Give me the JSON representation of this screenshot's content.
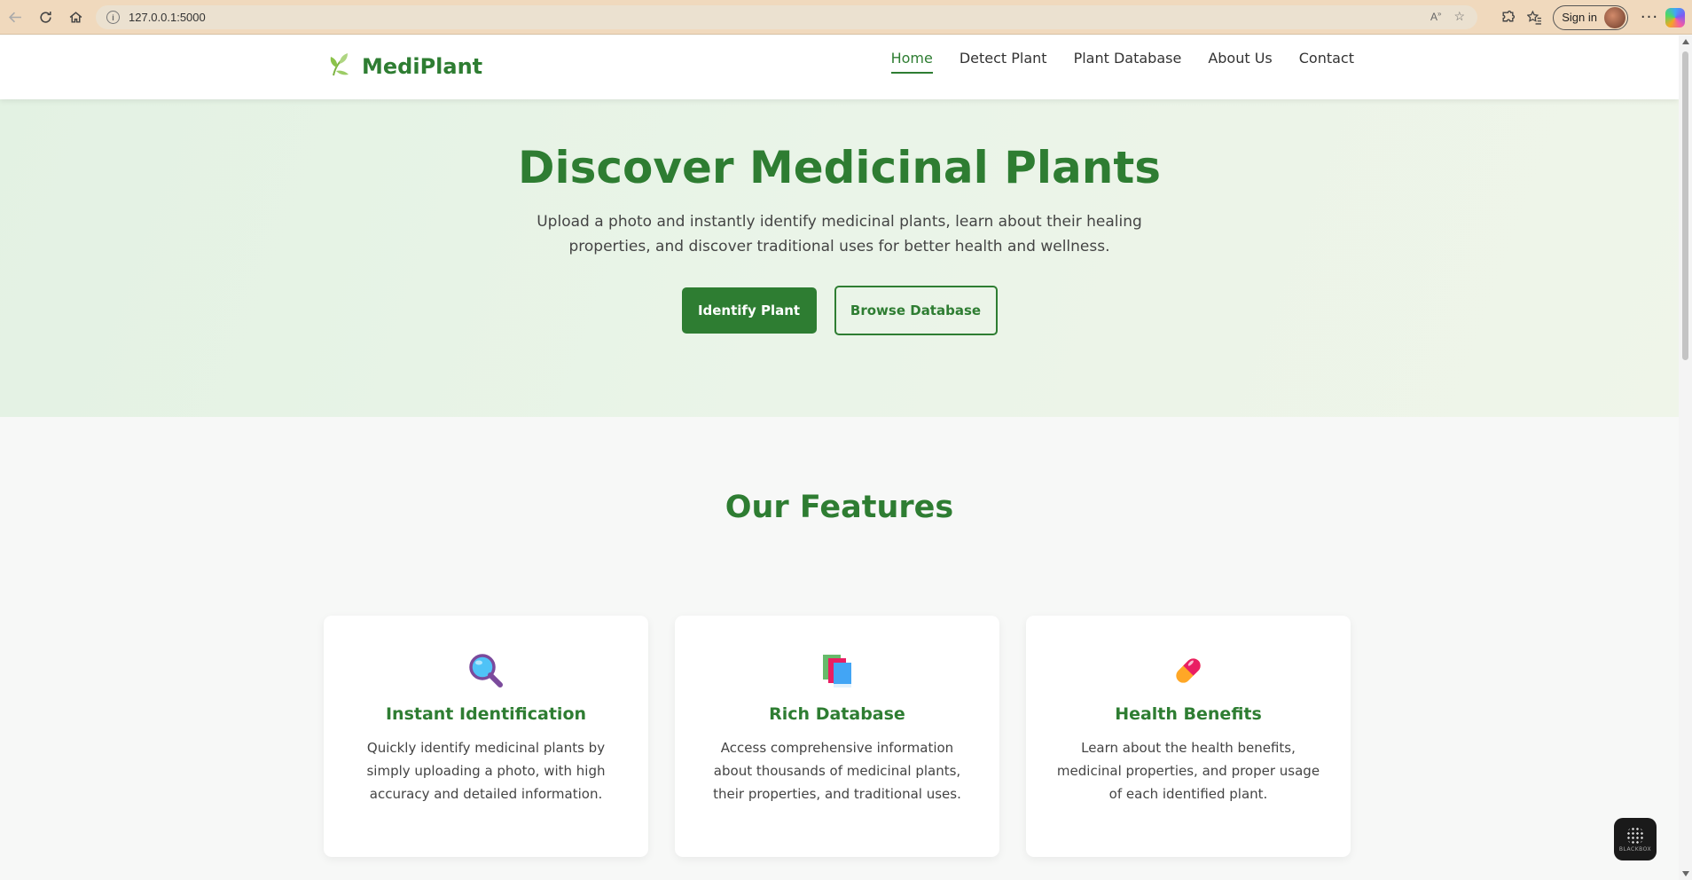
{
  "browser": {
    "url": "127.0.0.1:5000",
    "sign_in_label": "Sign in"
  },
  "site": {
    "brand": "MediPlant",
    "nav": [
      {
        "label": "Home",
        "active": true
      },
      {
        "label": "Detect Plant",
        "active": false
      },
      {
        "label": "Plant Database",
        "active": false
      },
      {
        "label": "About Us",
        "active": false
      },
      {
        "label": "Contact",
        "active": false
      }
    ]
  },
  "hero": {
    "title": "Discover Medicinal Plants",
    "subtitle": "Upload a photo and instantly identify medicinal plants, learn about their healing properties, and discover traditional uses for better health and wellness.",
    "primary_button": "Identify Plant",
    "secondary_button": "Browse Database"
  },
  "features": {
    "heading": "Our Features",
    "cards": [
      {
        "icon": "magnifier-icon",
        "title": "Instant Identification",
        "text": "Quickly identify medicinal plants by simply uploading a photo, with high accuracy and detailed information."
      },
      {
        "icon": "books-icon",
        "title": "Rich Database",
        "text": "Access comprehensive information about thousands of medicinal plants, their properties, and traditional uses."
      },
      {
        "icon": "pill-icon",
        "title": "Health Benefits",
        "text": "Learn about the health benefits, medicinal properties, and proper usage of each identified plant."
      }
    ]
  },
  "widget": {
    "label": "BLACKBOX"
  },
  "colors": {
    "brand_green": "#2e7d32",
    "hero_bg": "#e8f3e6",
    "chrome_bg": "#f0d9bd"
  }
}
